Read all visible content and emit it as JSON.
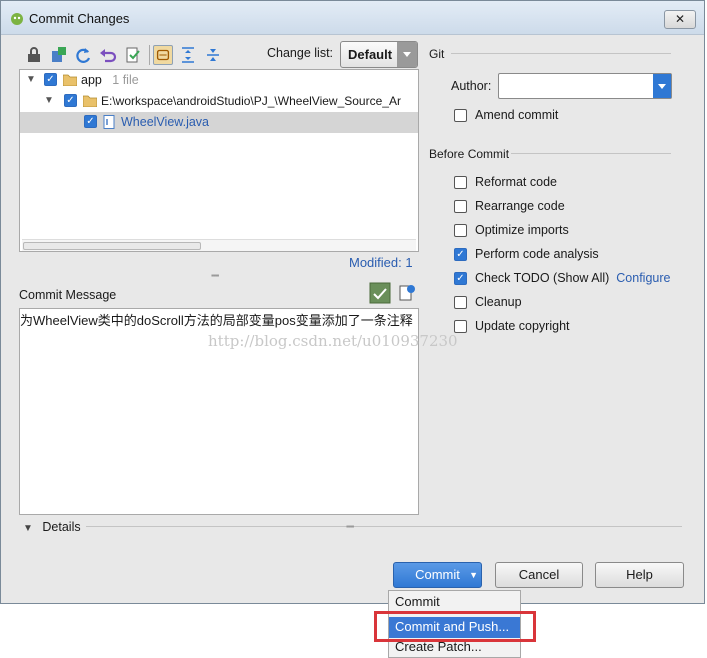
{
  "window": {
    "title": "Commit Changes",
    "close_glyph": "✕"
  },
  "toolbar": {
    "icons": [
      "refresh-remote-icon",
      "move-to-changelist-icon",
      "refresh-icon",
      "undo-icon",
      "diff-icon",
      "group-by-directory-icon",
      "expand-all-icon",
      "collapse-all-icon"
    ],
    "change_list_label": "Change list:",
    "change_list_value": "Default"
  },
  "file_tree": {
    "rows": [
      {
        "label": "app",
        "hint": "1 file"
      },
      {
        "label": "E:\\workspace\\androidStudio\\PJ_\\WheelView_Source_Ar"
      },
      {
        "label": "WheelView.java"
      }
    ],
    "modified_text": "Modified: 1"
  },
  "commit_message": {
    "label": "Commit Message",
    "text": "为WheelView类中的doScroll方法的局部变量pos变量添加了一条注释",
    "watermark": "http://blog.csdn.net/u010937230"
  },
  "git": {
    "section_title": "Git",
    "author_label": "Author:",
    "author_value": "",
    "amend_label": "Amend commit",
    "amend_checked": false
  },
  "before_commit": {
    "section_title": "Before Commit",
    "options": [
      {
        "label": "Reformat code",
        "checked": false
      },
      {
        "label": "Rearrange code",
        "checked": false
      },
      {
        "label": "Optimize imports",
        "checked": false
      },
      {
        "label": "Perform code analysis",
        "checked": true
      },
      {
        "label": "Check TODO (Show All)",
        "checked": true,
        "link": "Configure"
      },
      {
        "label": "Cleanup",
        "checked": false
      },
      {
        "label": "Update copyright",
        "checked": false
      }
    ]
  },
  "details": {
    "label": "Details"
  },
  "buttons": {
    "commit": "Commit",
    "cancel": "Cancel",
    "help": "Help"
  },
  "commit_menu": {
    "items": [
      "Commit",
      "Commit and Push...",
      "Create Patch..."
    ],
    "highlighted": 1
  },
  "colors": {
    "accent": "#2f78d4",
    "link": "#2a5db0",
    "highlight_box": "#d9353a"
  }
}
